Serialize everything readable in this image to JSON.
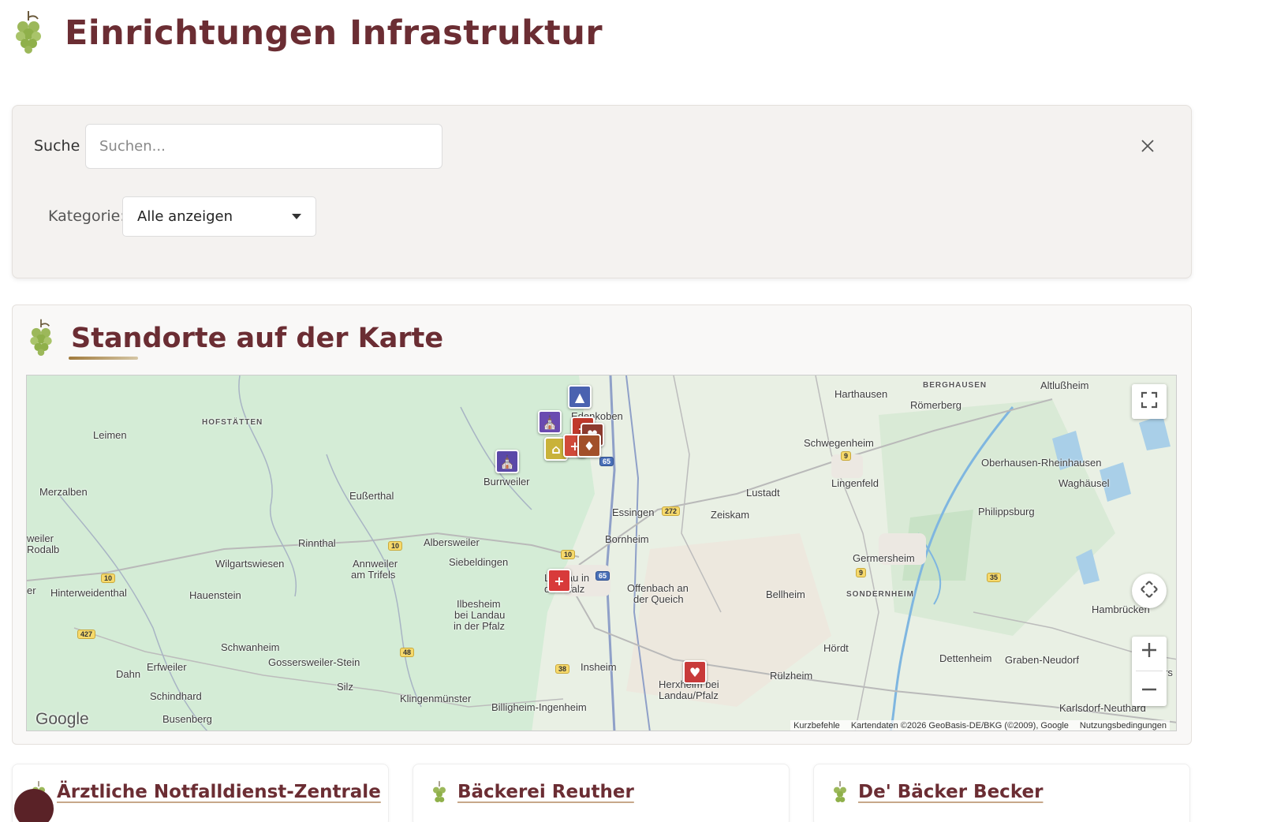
{
  "header": {
    "title": "Einrichtungen Infrastruktur",
    "logo_icon": "grape-icon"
  },
  "filters": {
    "search_label": "Suche",
    "search_placeholder": "Suchen...",
    "search_value": "",
    "clear_icon": "close-icon",
    "category_label": "Kategorie:",
    "category_selected": "Alle anzeigen"
  },
  "map_section": {
    "title": "Standorte auf der Karte",
    "provider_logo": "Google",
    "attribution": {
      "shortcuts": "Kurzbefehle",
      "data": "Kartendaten ©2026 GeoBasis-DE/BKG (©2009), Google",
      "terms": "Nutzungsbedingungen"
    },
    "place_labels": {
      "berghausen": "BERGHAUSEN",
      "altlussheim": "Altlußheim",
      "harthausen": "Harthausen",
      "roemerberg": "Römerberg",
      "hofstaetten": "HOFSTÄTTEN",
      "leimen": "Leimen",
      "edenkoben": "Edenkoben",
      "schwegenheim": "Schwegenheim",
      "oberhausen": "Oberhausen-Rheinhausen",
      "burrweiler": "Burrweiler",
      "lingenfeld": "Lingenfeld",
      "waghaeusel": "Waghäusel",
      "merzalben": "Merzalben",
      "eusserthal": "Eußerthal",
      "lustadt": "Lustadt",
      "philippsburg": "Philippsburg",
      "essingen": "Essingen",
      "zeiskam": "Zeiskam",
      "weiler": "weiler",
      "rodalb": "Rodalb",
      "rinnthal": "Rinnthal",
      "albersweiler": "Albersweiler",
      "bornheim": "Bornheim",
      "wilgartswiesen": "Wilgartswiesen",
      "annweiler": "Annweiler",
      "am_trifels": "am Trifels",
      "siebeldingen": "Siebeldingen",
      "germersheim": "Germersheim",
      "landau_1": "Landau in",
      "landau_2": "der Pfalz",
      "offenbach_1": "Offenbach an",
      "offenbach_2": "der Queich",
      "er": "er",
      "hinterweidenthal": "Hinterweidenthal",
      "hauenstein": "Hauenstein",
      "bellheim": "Bellheim",
      "sondernheim": "SONDERNHEIM",
      "hambruecken": "Hambrücken",
      "ilbesheim_1": "Ilbesheim",
      "ilbesheim_2": "bei Landau",
      "ilbesheim_3": "in der Pfalz",
      "schwanheim": "Schwanheim",
      "hoerdt": "Hördt",
      "dettenheim": "Dettenheim",
      "graben_neudorf": "Graben-Neudorf",
      "erfweiler": "Erfweiler",
      "gossersweiler": "Gossersweiler-Stein",
      "insheim": "Insheim",
      "dahn": "Dahn",
      "herxheim_1": "Herxheim bei",
      "herxheim_2": "Landau/Pfalz",
      "ruelzheim": "Rülzheim",
      "silz": "Silz",
      "schindhard": "Schindhard",
      "klingenmuenster": "Klingenmünster",
      "billigheim": "Billigheim-Ingenheim",
      "karlsdorf": "Karlsdorf-Neuthard",
      "busenberg": "Busenberg",
      "rs": "rs",
      "re": "Re"
    },
    "road_numbers": [
      "9",
      "65",
      "272",
      "10",
      "10",
      "10",
      "9",
      "65",
      "35",
      "427",
      "48",
      "38"
    ],
    "marker_types": [
      "hotel-icon",
      "church-icon",
      "bakery-icon",
      "medical-icon",
      "sports-icon",
      "church-icon",
      "medical-icon",
      "care-icon"
    ],
    "controls": [
      "fullscreen-icon",
      "pan-icon",
      "zoom-in-icon",
      "zoom-out-icon"
    ]
  },
  "cards": [
    {
      "title": "Ärztliche Notfalldienst-Zentrale"
    },
    {
      "title": "Bäckerei Reuther"
    },
    {
      "title": "De' Bäcker Becker"
    }
  ],
  "colors": {
    "brand": "#6b2d33",
    "grape": "#8fb04a",
    "accent_gold": "#a07a3c"
  }
}
